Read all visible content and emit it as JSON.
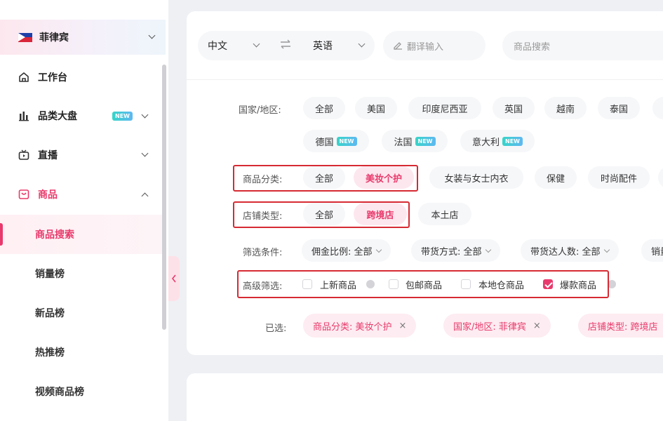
{
  "sidebar": {
    "country": "菲律宾",
    "nav": [
      {
        "label": "工作台"
      },
      {
        "label": "品类大盘",
        "badge": "NEW"
      },
      {
        "label": "直播"
      },
      {
        "label": "商品"
      }
    ],
    "sub_items": [
      "商品搜索",
      "销量榜",
      "新品榜",
      "热推榜",
      "视频商品榜"
    ],
    "active_sub": "商品搜索"
  },
  "toolbar": {
    "source_lang": "中文",
    "target_lang": "英语",
    "translate_placeholder": "翻译输入",
    "search_placeholder": "商品搜索"
  },
  "filters": {
    "country_label": "国家/地区:",
    "countries_row1": [
      "全部",
      "美国",
      "印度尼西亚",
      "英国",
      "越南",
      "泰国"
    ],
    "countries_row2": [
      {
        "name": "德国",
        "badge": "NEW"
      },
      {
        "name": "法国",
        "badge": "NEW"
      },
      {
        "name": "意大利",
        "badge": "NEW"
      }
    ],
    "category_label": "商品分类:",
    "categories": [
      "全部",
      "美妆个护",
      "女装与女士内衣",
      "保健",
      "时尚配件"
    ],
    "category_selected": "美妆个护",
    "shop_label": "店铺类型:",
    "shop_types": [
      "全部",
      "跨境店",
      "本土店"
    ],
    "shop_selected": "跨境店",
    "conditions_label": "筛选条件:",
    "conditions": [
      "佣金比例: 全部",
      "带货方式: 全部",
      "带货达人数: 全部",
      "销量"
    ],
    "advanced_label": "高级筛选:",
    "advanced": [
      {
        "label": "上新商品",
        "checked": false,
        "info": true
      },
      {
        "label": "包邮商品",
        "checked": false,
        "info": false
      },
      {
        "label": "本地仓商品",
        "checked": false,
        "info": false
      },
      {
        "label": "爆款商品",
        "checked": true,
        "info": true
      }
    ],
    "selected_label": "已选:",
    "selected_tags": [
      "商品分类: 美妆个护",
      "国家/地区: 菲律宾",
      "店铺类型: 跨境店"
    ]
  },
  "colors": {
    "accent": "#e83a6c",
    "highlight_box": "#d62a33",
    "chip_bg": "#f6f7f9"
  }
}
